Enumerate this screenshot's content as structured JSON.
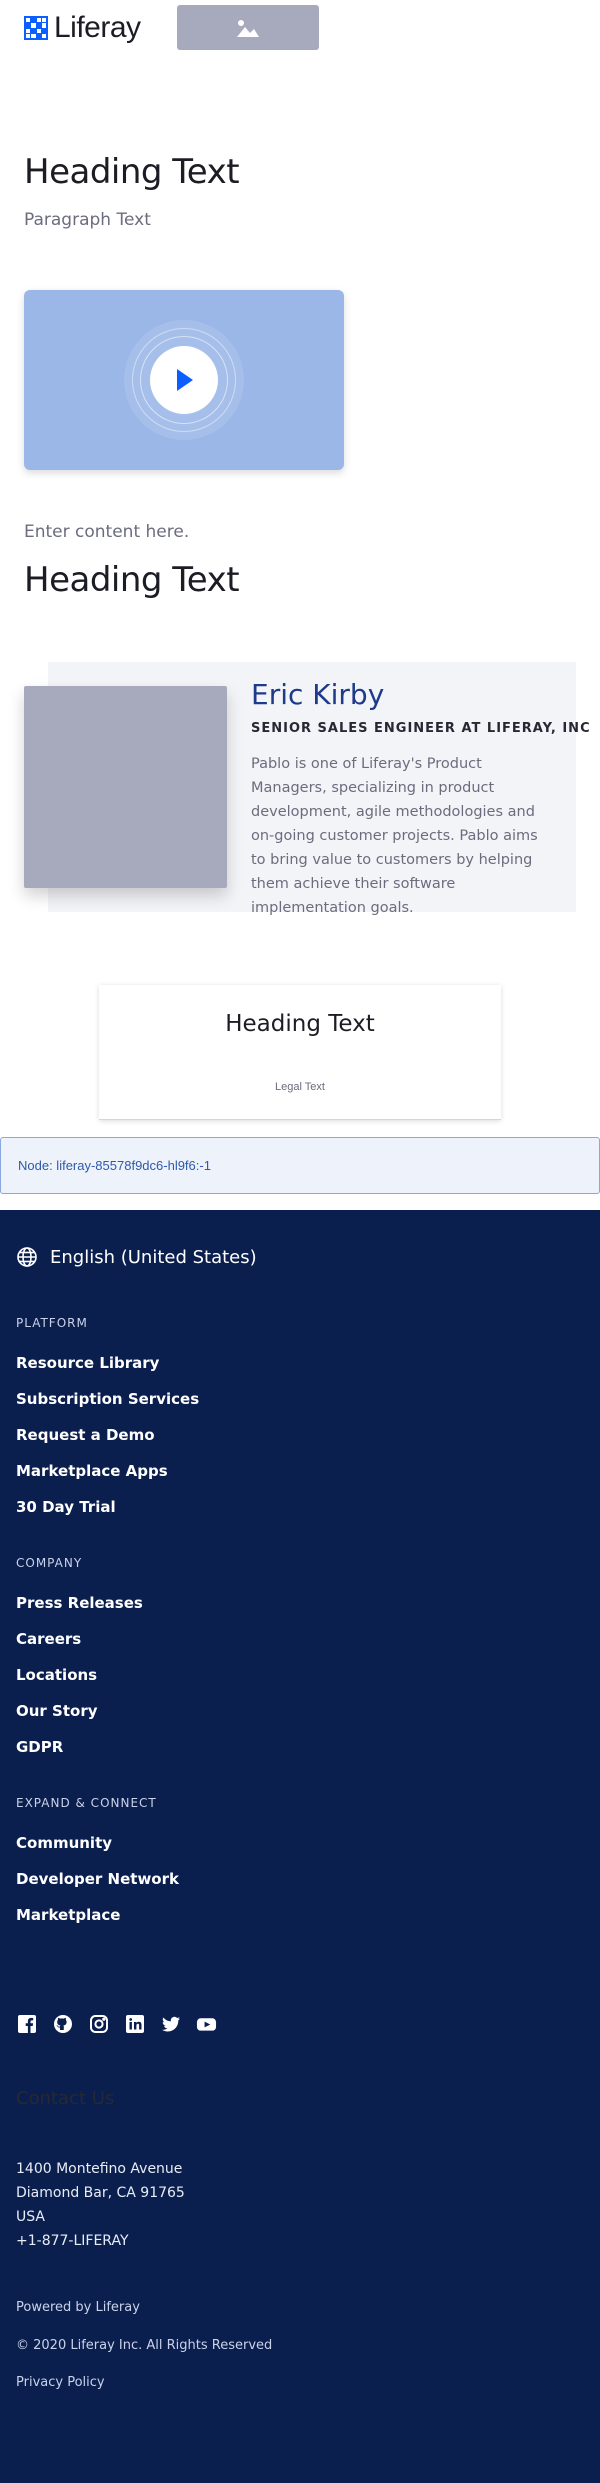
{
  "header": {
    "logo_text": "Liferay",
    "image_placeholder_icon": "image-icon"
  },
  "hero": {
    "heading": "Heading Text",
    "paragraph": "Paragraph Text"
  },
  "video": {
    "play_icon": "play-icon",
    "accent": "#0b5fff"
  },
  "content": {
    "text": "Enter content here.",
    "heading": "Heading Text"
  },
  "profile": {
    "name": "Eric Kirby",
    "role": "SENIOR SALES ENGINEER AT LIFERAY, INC",
    "bio": "Pablo is one of Liferay's Product Managers, specializing in product development, agile methodologies and on-going customer projects. Pablo aims to bring value to customers by helping them achieve their software implementation goals."
  },
  "card": {
    "title": "Heading Text",
    "legal": "Legal Text"
  },
  "node": {
    "text": "Node: liferay-85578f9dc6-hl9f6:-1"
  },
  "footer": {
    "language": "English (United States)",
    "platform": {
      "heading": "PLATFORM",
      "links": [
        "Resource Library",
        "Subscription Services",
        "Request a Demo",
        "Marketplace Apps",
        "30 Day Trial"
      ]
    },
    "company": {
      "heading": "COMPANY",
      "links": [
        "Press Releases",
        "Careers",
        "Locations",
        "Our Story",
        "GDPR"
      ]
    },
    "expand": {
      "heading": "EXPAND & CONNECT",
      "links": [
        "Community",
        "Developer Network",
        "Marketplace"
      ]
    },
    "social_icons": [
      "facebook-icon",
      "github-icon",
      "instagram-icon",
      "linkedin-icon",
      "twitter-icon",
      "youtube-icon"
    ],
    "contact_title": "Contact Us",
    "address": {
      "line1": "1400 Montefino Avenue",
      "line2": "Diamond Bar, CA 91765",
      "line3": "USA",
      "phone": "+1-877-LIFERAY"
    },
    "powered_by": "Powered by Liferay",
    "copyright": "© 2020 Liferay Inc. All Rights Reserved",
    "privacy": "Privacy Policy",
    "background": "#0b1f4f"
  }
}
